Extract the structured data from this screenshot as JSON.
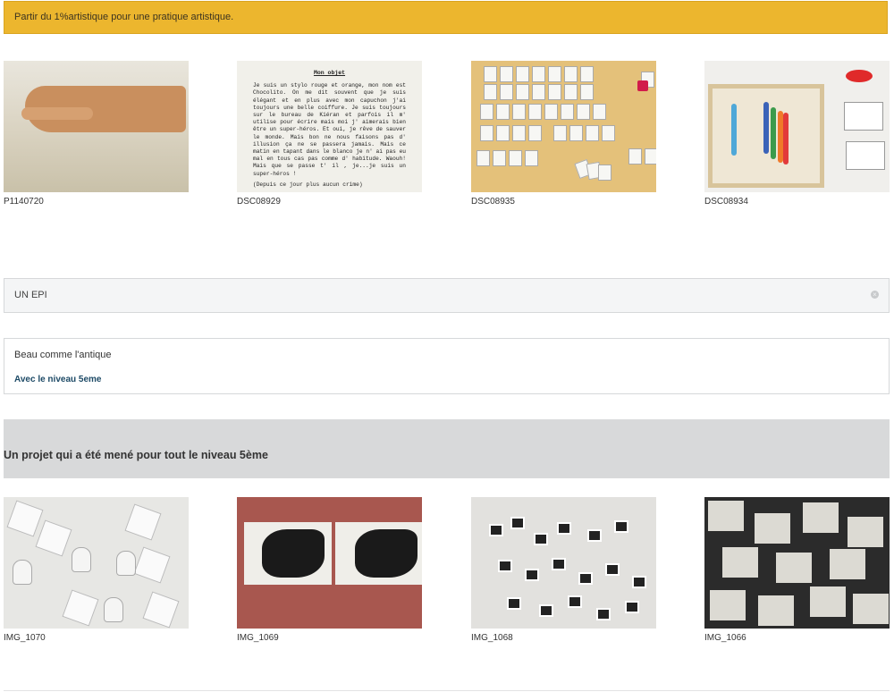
{
  "banner": {
    "text": "Partir du 1%artistique pour une pratique artistique."
  },
  "gallery1": [
    {
      "caption": "P1140720"
    },
    {
      "caption": "DSC08929",
      "doc_title": "Mon objet",
      "doc_text": "Je suis un stylo rouge et orange, mon nom est Chocolito. On me dit souvent que je suis élégant et en plus avec mon capuchon j'ai toujours une belle coiffure. Je suis toujours sur le bureau de Kiéran et parfois il m' utilise pour écrire mais moi j' aimerais bien être un super-héros. Et oui, je rêve de sauver le monde. Mais bon ne nous faisons pas d' illusion ça ne se passera jamais. Mais ce matin en tapant dans le blanco je n' ai pas eu mal en tous cas pas comme d' habitude. Waouh! Mais que se passe t' il , je...je suis un super-héros !",
      "doc_footer": "(Depuis ce jour plus aucun crime)"
    },
    {
      "caption": "DSC08935"
    },
    {
      "caption": "DSC08934"
    }
  ],
  "accordion": {
    "label": "UN EPI",
    "icon": "close-circle-icon"
  },
  "card": {
    "title": "Beau comme l'antique",
    "link": "Avec le niveau 5eme"
  },
  "section": {
    "heading": "Un projet qui a été mené pour tout le niveau 5ème"
  },
  "gallery2": [
    {
      "caption": "IMG_1070"
    },
    {
      "caption": "IMG_1069"
    },
    {
      "caption": "IMG_1068"
    },
    {
      "caption": "IMG_1066"
    }
  ],
  "colors": {
    "banner": "#ecb62e",
    "section_bg": "#d8d9da",
    "link": "#1d4a66"
  }
}
